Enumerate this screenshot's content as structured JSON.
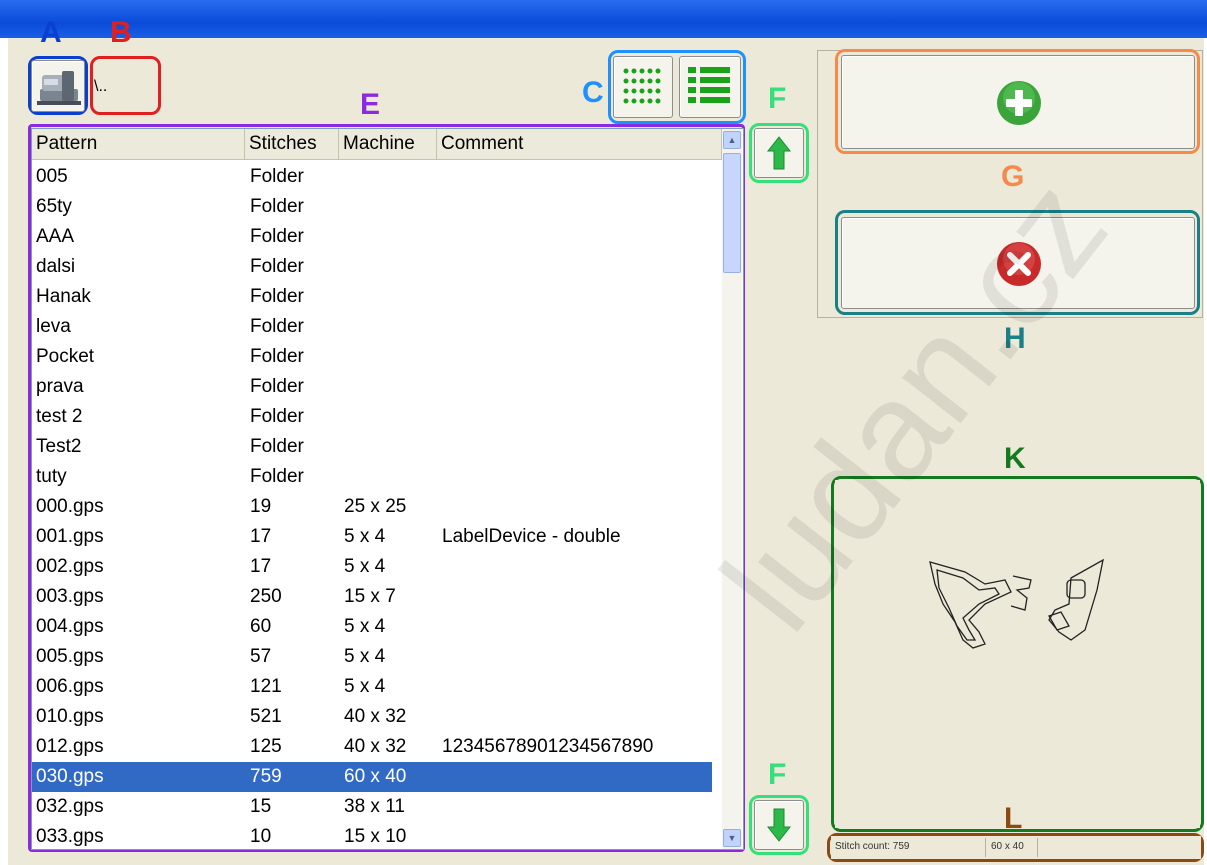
{
  "annotations": {
    "A": "A",
    "B": "B",
    "C": "C",
    "E": "E",
    "F": "F",
    "G": "G",
    "H": "H",
    "K": "K",
    "L": "L"
  },
  "path": {
    "value": "\\.."
  },
  "colors": {
    "blue": "#0a3fd0",
    "red": "#e02020",
    "lightblue": "#1e90ff",
    "purple": "#8a2be2",
    "green": "#33e07a",
    "orange": "#f58a4a",
    "teal": "#1a7f86",
    "darkgreen": "#137a1e",
    "brown": "#8b4a12",
    "selection": "#316ac5"
  },
  "icons": {
    "machine": "sewing-machine-icon",
    "view_grid": "grid-view-icon",
    "view_list": "list-view-icon",
    "up": "arrow-up-icon",
    "down": "arrow-down-icon",
    "add": "plus-icon",
    "cancel": "cancel-icon"
  },
  "list": {
    "columns": [
      "Pattern",
      "Stitches",
      "Machine",
      "Comment"
    ],
    "rows": [
      {
        "pattern": "005",
        "stitches": "Folder",
        "machine": "",
        "comment": ""
      },
      {
        "pattern": "65ty",
        "stitches": "Folder",
        "machine": "",
        "comment": ""
      },
      {
        "pattern": "AAA",
        "stitches": "Folder",
        "machine": "",
        "comment": ""
      },
      {
        "pattern": "dalsi",
        "stitches": "Folder",
        "machine": "",
        "comment": ""
      },
      {
        "pattern": "Hanak",
        "stitches": "Folder",
        "machine": "",
        "comment": ""
      },
      {
        "pattern": "leva",
        "stitches": "Folder",
        "machine": "",
        "comment": ""
      },
      {
        "pattern": "Pocket",
        "stitches": "Folder",
        "machine": "",
        "comment": ""
      },
      {
        "pattern": "prava",
        "stitches": "Folder",
        "machine": "",
        "comment": ""
      },
      {
        "pattern": "test 2",
        "stitches": "Folder",
        "machine": "",
        "comment": ""
      },
      {
        "pattern": "Test2",
        "stitches": "Folder",
        "machine": "",
        "comment": ""
      },
      {
        "pattern": "tuty",
        "stitches": "Folder",
        "machine": "",
        "comment": ""
      },
      {
        "pattern": "000.gps",
        "stitches": "19",
        "machine": "25 x 25",
        "comment": ""
      },
      {
        "pattern": "001.gps",
        "stitches": "17",
        "machine": "5 x 4",
        "comment": "LabelDevice - double"
      },
      {
        "pattern": "002.gps",
        "stitches": "17",
        "machine": "5 x 4",
        "comment": ""
      },
      {
        "pattern": "003.gps",
        "stitches": "250",
        "machine": "15 x 7",
        "comment": ""
      },
      {
        "pattern": "004.gps",
        "stitches": "60",
        "machine": "5 x 4",
        "comment": ""
      },
      {
        "pattern": "005.gps",
        "stitches": "57",
        "machine": "5 x 4",
        "comment": ""
      },
      {
        "pattern": "006.gps",
        "stitches": "121",
        "machine": "5 x 4",
        "comment": ""
      },
      {
        "pattern": "010.gps",
        "stitches": "521",
        "machine": "40 x 32",
        "comment": ""
      },
      {
        "pattern": "012.gps",
        "stitches": "125",
        "machine": "40 x 32",
        "comment": "12345678901234567890"
      },
      {
        "pattern": "030.gps",
        "stitches": "759",
        "machine": "60 x 40",
        "comment": "",
        "selected": true
      },
      {
        "pattern": "032.gps",
        "stitches": "15",
        "machine": "38 x 11",
        "comment": ""
      },
      {
        "pattern": "033.gps",
        "stitches": "10",
        "machine": "15 x 10",
        "comment": ""
      }
    ]
  },
  "status": {
    "stitch_count": "Stitch count: 759",
    "size": "60 x 40"
  },
  "watermark": "ludan.cz"
}
